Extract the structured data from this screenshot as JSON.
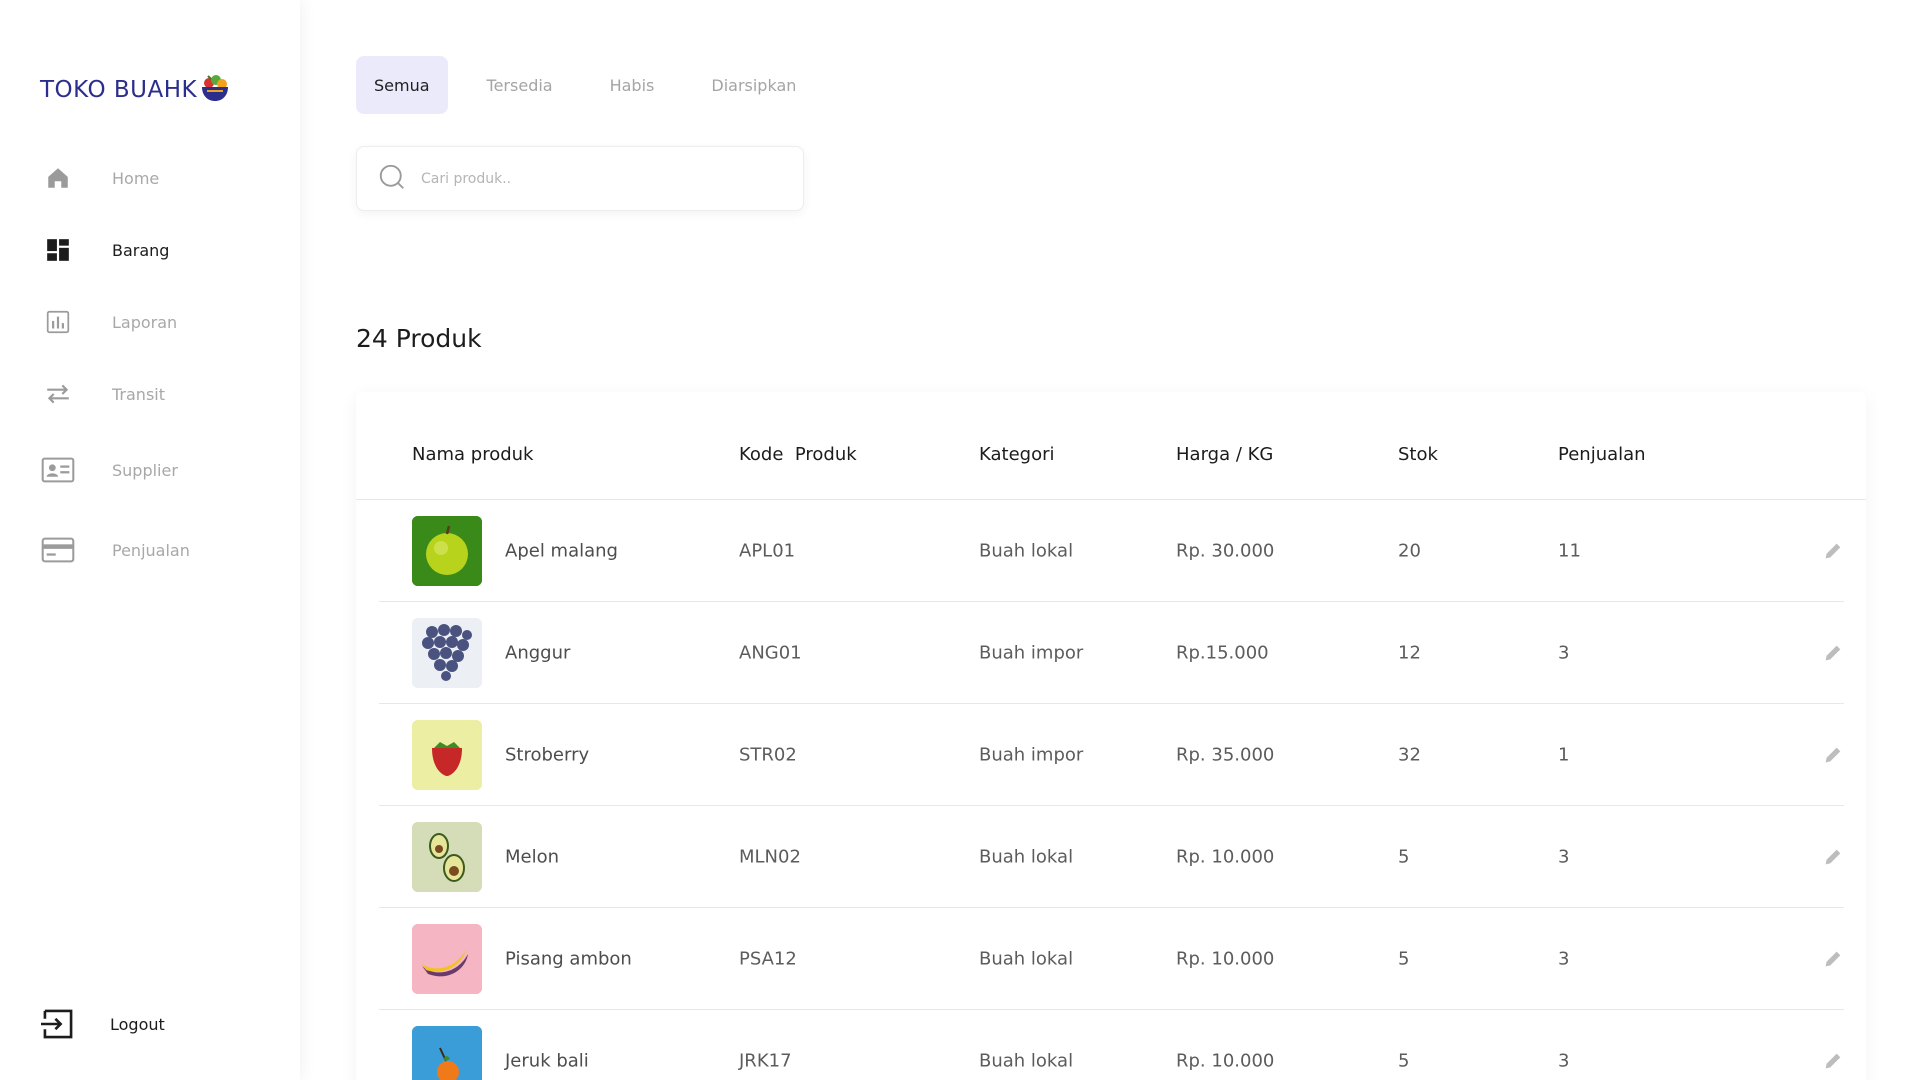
{
  "app": {
    "logo_text": "TOKO BUAHK"
  },
  "sidebar": {
    "items": [
      {
        "label": "Home",
        "icon": "home-icon"
      },
      {
        "label": "Barang",
        "icon": "dashboard-icon"
      },
      {
        "label": "Laporan",
        "icon": "chart-icon"
      },
      {
        "label": "Transit",
        "icon": "transfer-icon"
      },
      {
        "label": "Supplier",
        "icon": "contact-card-icon"
      },
      {
        "label": "Penjualan",
        "icon": "credit-card-icon"
      }
    ],
    "active": "Barang",
    "logout_label": "Logout"
  },
  "tabs": [
    "Semua",
    "Tersedia",
    "Habis",
    "Diarsipkan"
  ],
  "active_tab": "Semua",
  "search": {
    "placeholder": "Cari produk.."
  },
  "product_count_title": "24 Produk",
  "table": {
    "headers": [
      "Nama produk",
      "Kode  Produk",
      "Kategori",
      "Harga / KG",
      "Stok",
      "Penjualan"
    ],
    "rows": [
      {
        "name": "Apel malang",
        "code": "APL01",
        "category": "Buah lokal",
        "price": "Rp. 30.000",
        "stock": "20",
        "sales": "11",
        "image": "apple"
      },
      {
        "name": "Anggur",
        "code": "ANG01",
        "category": "Buah impor",
        "price": "Rp.15.000",
        "stock": "12",
        "sales": "3",
        "image": "grape"
      },
      {
        "name": "Stroberry",
        "code": "STR02",
        "category": "Buah impor",
        "price": "Rp. 35.000",
        "stock": "32",
        "sales": "1",
        "image": "strawberry"
      },
      {
        "name": "Melon",
        "code": "MLN02",
        "category": "Buah lokal",
        "price": "Rp. 10.000",
        "stock": "5",
        "sales": "3",
        "image": "avocado"
      },
      {
        "name": "Pisang ambon",
        "code": "PSA12",
        "category": "Buah lokal",
        "price": "Rp. 10.000",
        "stock": "5",
        "sales": "3",
        "image": "banana"
      },
      {
        "name": "Jeruk bali",
        "code": "JRK17",
        "category": "Buah lokal",
        "price": "Rp. 10.000",
        "stock": "5",
        "sales": "3",
        "image": "orange"
      }
    ]
  },
  "colors": {
    "accent": "#2b2e8c",
    "active_tab_bg": "#ebeafb"
  }
}
